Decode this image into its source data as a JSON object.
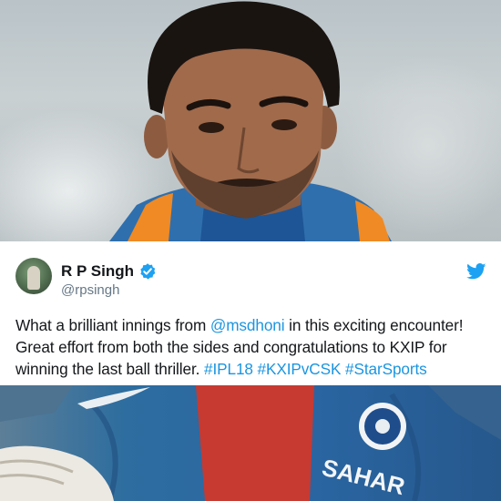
{
  "tweet": {
    "display_name": "R P Singh",
    "handle": "@rpsingh",
    "text_parts": [
      {
        "text": "What a brilliant innings from ",
        "type": "text"
      },
      {
        "text": "@msdhoni",
        "type": "mention"
      },
      {
        "text": "  in this exciting encounter! Great effort from both the sides and congratulations to KXIP for winning the last ball thriller. ",
        "type": "text"
      },
      {
        "text": "#IPL18",
        "type": "hashtag"
      },
      {
        "text": " ",
        "type": "text"
      },
      {
        "text": "#KXIPvCSK",
        "type": "hashtag"
      },
      {
        "text": " ",
        "type": "text"
      },
      {
        "text": "#StarSports",
        "type": "hashtag"
      }
    ],
    "verified_icon": "verified-badge-icon",
    "brand_icon": "twitter-bird-icon"
  },
  "photo_bottom": {
    "jersey_text": "SAHAR"
  },
  "colors": {
    "link": "#1b95e0",
    "verified": "#1da1f2",
    "text": "#14171a",
    "secondary": "#657786",
    "jersey_blue": "#2a66a3"
  }
}
